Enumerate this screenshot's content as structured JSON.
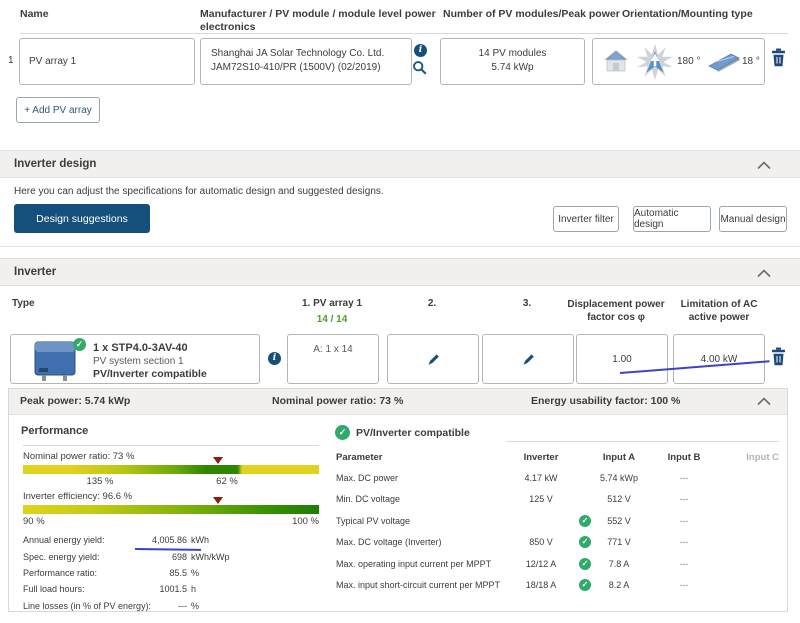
{
  "colors": {
    "accent_navy": "#15507c",
    "green_check": "#2faa6a",
    "green_text": "#4c9c2e",
    "bar_yellow": "#e0d31d",
    "bar_green": "#2e8500",
    "marker_red": "#8c1c12",
    "annotation_blue": "#3d44c3"
  },
  "icons": {
    "check": "✓",
    "info": "i",
    "plus": "+"
  },
  "pv_table": {
    "headers": {
      "name": "Name",
      "manufacturer_line1": "Manufacturer / PV module / module level power",
      "manufacturer_line2": "electronics",
      "modules": "Number of PV modules/Peak power",
      "orientation": "Orientation/Mounting type"
    },
    "row": {
      "index": "1",
      "name": "PV array 1",
      "manufacturer_line1": "Shanghai JA Solar Technology Co. Ltd.",
      "manufacturer_line2": "JAM72S10-410/PR (1500V) (02/2019)",
      "modules_line1": "14 PV modules",
      "modules_line2": "5.74 kWp",
      "azimuth": "180 °",
      "tilt": "18 °"
    },
    "add_button": "+ Add PV array"
  },
  "inverter_design": {
    "title": "Inverter design",
    "description": "Here you can adjust the specifications for automatic design and suggested designs.",
    "design_suggestions": "Design suggestions",
    "inverter_filter": "Inverter filter",
    "automatic_design": "Automatic design",
    "manual_design": "Manual design"
  },
  "inverter": {
    "title": "Inverter",
    "columns": {
      "type": "Type",
      "array1": "1. PV array 1",
      "array1_count": "14 / 14",
      "col2": "2.",
      "col3": "3.",
      "displacement_line1": "Displacement power",
      "displacement_line2": "factor cos φ",
      "limitation_line1": "Limitation of AC",
      "limitation_line2": "active power"
    },
    "row": {
      "name": "1 x STP4.0-3AV-40",
      "section": "PV system section 1",
      "compat": "PV/Inverter compatible",
      "array1_value": "A: 1 x 14",
      "cos_phi": "1.00",
      "ac_limit": "4.00 kW"
    }
  },
  "summary": {
    "peak_power": "Peak power: 5.74 kWp",
    "nominal_power_ratio": "Nominal power ratio: 73 %",
    "energy_usability": "Energy usability factor: 100 %"
  },
  "performance": {
    "title": "Performance",
    "npr_label": "Nominal power ratio: 73 %",
    "npr_tick_left": "135 %",
    "npr_tick_right": "62 %",
    "eff_label": "Inverter efficiency: 96.6 %",
    "eff_tick_left": "90 %",
    "eff_tick_right": "100 %",
    "rows": [
      {
        "label": "Annual energy yield:",
        "value": "4,005.86",
        "unit": "kWh"
      },
      {
        "label": "Spec. energy yield:",
        "value": "698",
        "unit": "kWh/kWp"
      },
      {
        "label": "Performance ratio:",
        "value": "85.5",
        "unit": "%"
      },
      {
        "label": "Full load hours:",
        "value": "1001.5",
        "unit": "h"
      },
      {
        "label": "Line losses (in % of PV energy):",
        "value": "---",
        "unit": "%"
      }
    ]
  },
  "compat": {
    "title": "PV/Inverter compatible",
    "headers": {
      "param": "Parameter",
      "inverter": "Inverter",
      "a": "Input A",
      "b": "Input B",
      "c": "Input C"
    },
    "rows": [
      {
        "param": "Max. DC power",
        "inverter": "4.17 kW",
        "a": "5.74 kWp",
        "b": "---"
      },
      {
        "param": "Min. DC voltage",
        "inverter": "125 V",
        "a": "512 V",
        "b": "---"
      },
      {
        "param": "Typical PV voltage",
        "inverter": "",
        "a": "552 V",
        "b": "---"
      },
      {
        "param": "Max. DC voltage (Inverter)",
        "inverter": "850 V",
        "a": "771 V",
        "b": "---"
      },
      {
        "param": "Max. operating input current per MPPT",
        "inverter": "12/12 A",
        "a": "7.8 A",
        "b": "---"
      },
      {
        "param": "Max. input short-circuit current per MPPT",
        "inverter": "18/18 A",
        "a": "8.2 A",
        "b": "---"
      }
    ]
  }
}
